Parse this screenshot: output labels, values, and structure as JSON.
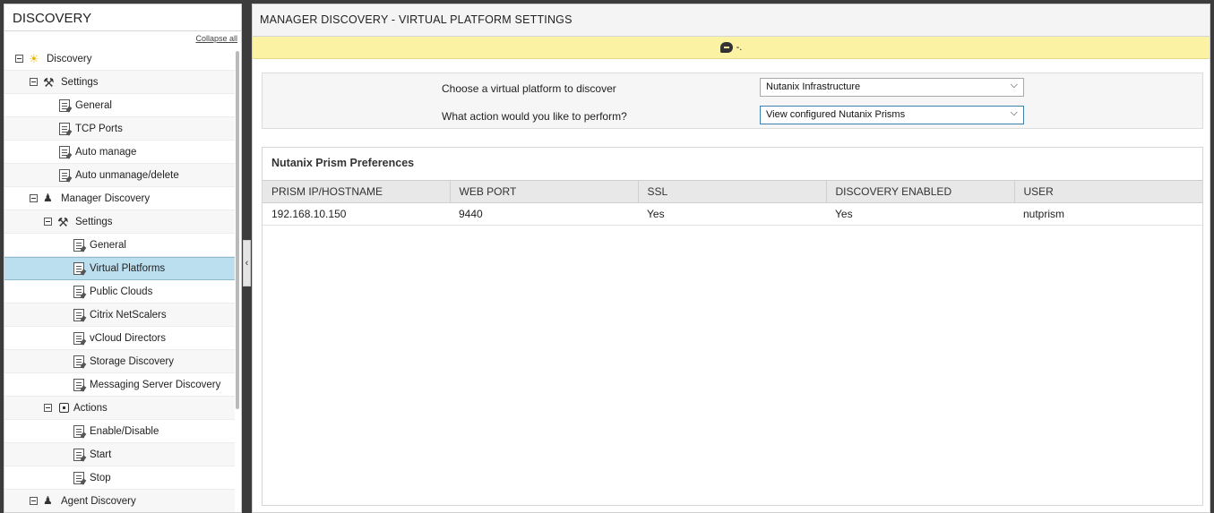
{
  "left_panel": {
    "title": "DISCOVERY",
    "collapse_all": "Collapse all",
    "tree": [
      {
        "label": "Discovery",
        "indent": 0,
        "toggle": true,
        "icon": "bulb-icon"
      },
      {
        "label": "Settings",
        "indent": 1,
        "toggle": true,
        "icon": "tools-icon"
      },
      {
        "label": "General",
        "indent": 2,
        "toggle": false,
        "icon": "document-icon"
      },
      {
        "label": "TCP Ports",
        "indent": 2,
        "toggle": false,
        "icon": "document-icon"
      },
      {
        "label": "Auto manage",
        "indent": 2,
        "toggle": false,
        "icon": "document-icon"
      },
      {
        "label": "Auto unmanage/delete",
        "indent": 2,
        "toggle": false,
        "icon": "document-icon"
      },
      {
        "label": "Manager Discovery",
        "indent": 1,
        "toggle": true,
        "icon": "users-icon"
      },
      {
        "label": "Settings",
        "indent": 2,
        "toggle": true,
        "icon": "tools-icon"
      },
      {
        "label": "General",
        "indent": 3,
        "toggle": false,
        "icon": "document-icon"
      },
      {
        "label": "Virtual Platforms",
        "indent": 3,
        "toggle": false,
        "icon": "document-icon",
        "selected": true
      },
      {
        "label": "Public Clouds",
        "indent": 3,
        "toggle": false,
        "icon": "document-icon"
      },
      {
        "label": "Citrix NetScalers",
        "indent": 3,
        "toggle": false,
        "icon": "document-icon"
      },
      {
        "label": "vCloud Directors",
        "indent": 3,
        "toggle": false,
        "icon": "document-icon"
      },
      {
        "label": "Storage Discovery",
        "indent": 3,
        "toggle": false,
        "icon": "document-icon"
      },
      {
        "label": "Messaging Server Discovery",
        "indent": 3,
        "toggle": false,
        "icon": "document-icon"
      },
      {
        "label": "Actions",
        "indent": 2,
        "toggle": true,
        "icon": "actions-icon"
      },
      {
        "label": "Enable/Disable",
        "indent": 3,
        "toggle": false,
        "icon": "document-icon"
      },
      {
        "label": "Start",
        "indent": 3,
        "toggle": false,
        "icon": "document-icon"
      },
      {
        "label": "Stop",
        "indent": 3,
        "toggle": false,
        "icon": "document-icon"
      },
      {
        "label": "Agent Discovery",
        "indent": 1,
        "toggle": true,
        "icon": "users-icon"
      }
    ]
  },
  "main": {
    "header": "MANAGER DISCOVERY - VIRTUAL PLATFORM SETTINGS",
    "message": "-.",
    "form": {
      "platform_label": "Choose a virtual platform to discover",
      "platform_value": "Nutanix Infrastructure",
      "action_label": "What action would you like to perform?",
      "action_value": "View configured Nutanix Prisms"
    },
    "prefs": {
      "title": "Nutanix Prism Preferences",
      "columns": [
        "PRISM IP/HOSTNAME",
        "WEB PORT",
        "SSL",
        "DISCOVERY ENABLED",
        "USER"
      ],
      "rows": [
        [
          "192.168.10.150",
          "9440",
          "Yes",
          "Yes",
          "nutprism"
        ]
      ]
    }
  },
  "colors": {
    "selected_row": "#bcdff0",
    "message_bar": "#fbf3a3",
    "table_header": "#e8e8e8"
  }
}
